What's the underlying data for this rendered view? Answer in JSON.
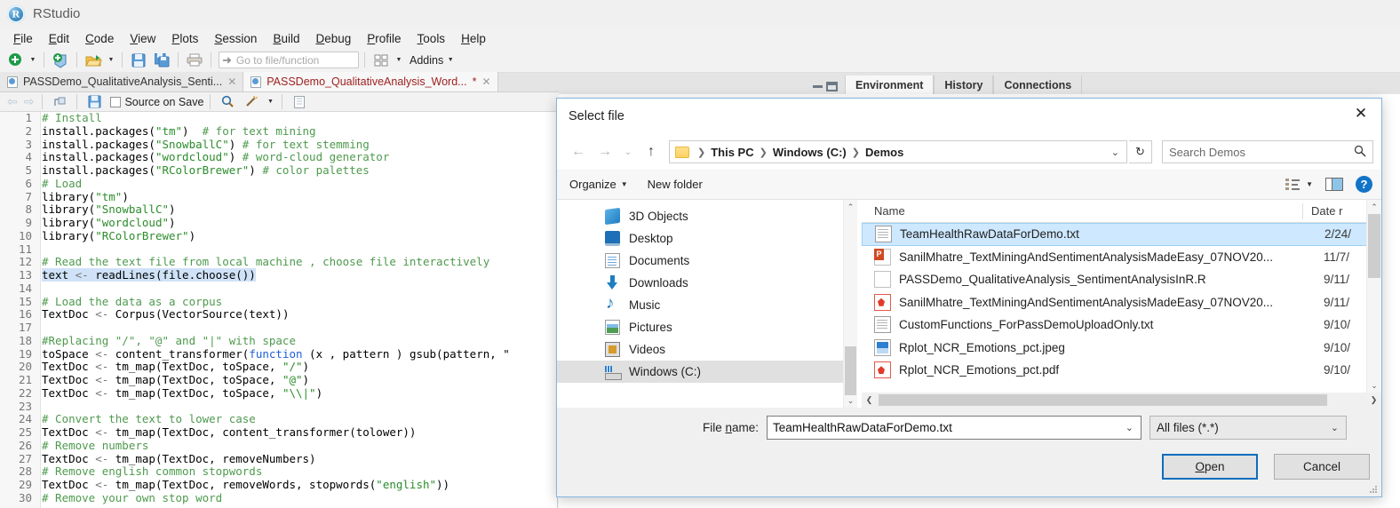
{
  "app": {
    "title": "RStudio",
    "logo_icon": "rstudio-logo"
  },
  "menubar": {
    "items": [
      {
        "label": "File",
        "mnemonic": "F"
      },
      {
        "label": "Edit",
        "mnemonic": "E"
      },
      {
        "label": "Code",
        "mnemonic": "C"
      },
      {
        "label": "View",
        "mnemonic": "V"
      },
      {
        "label": "Plots",
        "mnemonic": "P"
      },
      {
        "label": "Session",
        "mnemonic": "S"
      },
      {
        "label": "Build",
        "mnemonic": "B"
      },
      {
        "label": "Debug",
        "mnemonic": "D"
      },
      {
        "label": "Profile",
        "mnemonic": "P"
      },
      {
        "label": "Tools",
        "mnemonic": "T"
      },
      {
        "label": "Help",
        "mnemonic": "H"
      }
    ]
  },
  "toolbar": {
    "new_file_icon": "new-file-icon",
    "new_project_icon": "new-project-icon",
    "open_file_icon": "open-folder-icon",
    "save_icon": "save-icon",
    "save_all_icon": "save-all-icon",
    "print_icon": "print-icon",
    "goto_placeholder": "Go to file/function",
    "goto_icon": "goto-arrow-icon",
    "panes_icon": "workspace-panes-icon",
    "addins_label": "Addins"
  },
  "source_tabs": [
    {
      "label": "PASSDemo_QualitativeAnalysis_Senti...",
      "active": false,
      "modified": false
    },
    {
      "label": "PASSDemo_QualitativeAnalysis_Word...",
      "active": true,
      "modified": true,
      "modified_mark": "*"
    }
  ],
  "editor_toolbar": {
    "back_icon": "back-arrow-icon",
    "forward_icon": "forward-arrow-icon",
    "popout_icon": "show-in-new-window-icon",
    "save_icon": "save-icon",
    "source_on_save_label": "Source on Save",
    "find_icon": "magnifier-icon",
    "magic_icon": "code-tools-icon",
    "outline_icon": "document-outline-icon"
  },
  "code": {
    "lines": [
      {
        "n": 1,
        "segs": [
          {
            "t": "# Install",
            "c": "cm"
          }
        ]
      },
      {
        "n": 2,
        "segs": [
          {
            "t": "install.packages(",
            "c": ""
          },
          {
            "t": "\"tm\"",
            "c": "st"
          },
          {
            "t": ")  ",
            "c": ""
          },
          {
            "t": "# for text mining",
            "c": "cm"
          }
        ]
      },
      {
        "n": 3,
        "segs": [
          {
            "t": "install.packages(",
            "c": ""
          },
          {
            "t": "\"SnowballC\"",
            "c": "st"
          },
          {
            "t": ") ",
            "c": ""
          },
          {
            "t": "# for text stemming",
            "c": "cm"
          }
        ]
      },
      {
        "n": 4,
        "segs": [
          {
            "t": "install.packages(",
            "c": ""
          },
          {
            "t": "\"wordcloud\"",
            "c": "st"
          },
          {
            "t": ") ",
            "c": ""
          },
          {
            "t": "# word-cloud generator",
            "c": "cm"
          }
        ]
      },
      {
        "n": 5,
        "segs": [
          {
            "t": "install.packages(",
            "c": ""
          },
          {
            "t": "\"RColorBrewer\"",
            "c": "st"
          },
          {
            "t": ") ",
            "c": ""
          },
          {
            "t": "# color palettes",
            "c": "cm"
          }
        ]
      },
      {
        "n": 6,
        "segs": [
          {
            "t": "# Load",
            "c": "cm"
          }
        ]
      },
      {
        "n": 7,
        "segs": [
          {
            "t": "library(",
            "c": ""
          },
          {
            "t": "\"tm\"",
            "c": "st"
          },
          {
            "t": ")",
            "c": ""
          }
        ]
      },
      {
        "n": 8,
        "segs": [
          {
            "t": "library(",
            "c": ""
          },
          {
            "t": "\"SnowballC\"",
            "c": "st"
          },
          {
            "t": ")",
            "c": ""
          }
        ]
      },
      {
        "n": 9,
        "segs": [
          {
            "t": "library(",
            "c": ""
          },
          {
            "t": "\"wordcloud\"",
            "c": "st"
          },
          {
            "t": ")",
            "c": ""
          }
        ]
      },
      {
        "n": 10,
        "segs": [
          {
            "t": "library(",
            "c": ""
          },
          {
            "t": "\"RColorBrewer\"",
            "c": "st"
          },
          {
            "t": ")",
            "c": ""
          }
        ]
      },
      {
        "n": 11,
        "segs": []
      },
      {
        "n": 12,
        "segs": [
          {
            "t": "# Read the text file from local machine , choose file interactively",
            "c": "cm"
          }
        ]
      },
      {
        "n": 13,
        "segs": [
          {
            "t": "text ",
            "c": "sel"
          },
          {
            "t": "<- ",
            "c": "sel op"
          },
          {
            "t": "readLines(file.choose())",
            "c": "sel"
          }
        ]
      },
      {
        "n": 14,
        "segs": []
      },
      {
        "n": 15,
        "segs": [
          {
            "t": "# Load the data as a corpus",
            "c": "cm"
          }
        ]
      },
      {
        "n": 16,
        "segs": [
          {
            "t": "TextDoc ",
            "c": ""
          },
          {
            "t": "<- ",
            "c": "op"
          },
          {
            "t": "Corpus(VectorSource(text))",
            "c": ""
          }
        ]
      },
      {
        "n": 17,
        "segs": []
      },
      {
        "n": 18,
        "segs": [
          {
            "t": "#Replacing \"/\", \"@\" and \"|\" with space",
            "c": "cm"
          }
        ]
      },
      {
        "n": 19,
        "segs": [
          {
            "t": "toSpace ",
            "c": ""
          },
          {
            "t": "<- ",
            "c": "op"
          },
          {
            "t": "content_transformer(",
            "c": ""
          },
          {
            "t": "function",
            "c": "kw"
          },
          {
            "t": " (x , pattern ) gsub(pattern, \"",
            "c": ""
          }
        ]
      },
      {
        "n": 20,
        "segs": [
          {
            "t": "TextDoc ",
            "c": ""
          },
          {
            "t": "<- ",
            "c": "op"
          },
          {
            "t": "tm_map(TextDoc, toSpace, ",
            "c": ""
          },
          {
            "t": "\"/\"",
            "c": "st"
          },
          {
            "t": ")",
            "c": ""
          }
        ]
      },
      {
        "n": 21,
        "segs": [
          {
            "t": "TextDoc ",
            "c": ""
          },
          {
            "t": "<- ",
            "c": "op"
          },
          {
            "t": "tm_map(TextDoc, toSpace, ",
            "c": ""
          },
          {
            "t": "\"@\"",
            "c": "st"
          },
          {
            "t": ")",
            "c": ""
          }
        ]
      },
      {
        "n": 22,
        "segs": [
          {
            "t": "TextDoc ",
            "c": ""
          },
          {
            "t": "<- ",
            "c": "op"
          },
          {
            "t": "tm_map(TextDoc, toSpace, ",
            "c": ""
          },
          {
            "t": "\"\\\\|\"",
            "c": "st"
          },
          {
            "t": ")",
            "c": ""
          }
        ]
      },
      {
        "n": 23,
        "segs": []
      },
      {
        "n": 24,
        "segs": [
          {
            "t": "# Convert the text to lower case",
            "c": "cm"
          }
        ]
      },
      {
        "n": 25,
        "segs": [
          {
            "t": "TextDoc ",
            "c": ""
          },
          {
            "t": "<- ",
            "c": "op"
          },
          {
            "t": "tm_map(TextDoc, content_transformer(tolower))",
            "c": ""
          }
        ]
      },
      {
        "n": 26,
        "segs": [
          {
            "t": "# Remove numbers",
            "c": "cm"
          }
        ]
      },
      {
        "n": 27,
        "segs": [
          {
            "t": "TextDoc ",
            "c": ""
          },
          {
            "t": "<- ",
            "c": "op"
          },
          {
            "t": "tm_map(TextDoc, removeNumbers)",
            "c": ""
          }
        ]
      },
      {
        "n": 28,
        "segs": [
          {
            "t": "# Remove english common stopwords",
            "c": "cm"
          }
        ]
      },
      {
        "n": 29,
        "segs": [
          {
            "t": "TextDoc ",
            "c": ""
          },
          {
            "t": "<- ",
            "c": "op"
          },
          {
            "t": "tm_map(TextDoc, removeWords, stopwords(",
            "c": ""
          },
          {
            "t": "\"english\"",
            "c": "st"
          },
          {
            "t": "))",
            "c": ""
          }
        ]
      },
      {
        "n": 30,
        "segs": [
          {
            "t": "# Remove your own stop word",
            "c": "cm"
          }
        ]
      }
    ]
  },
  "right_pane": {
    "tabs": [
      {
        "label": "Environment",
        "active": true
      },
      {
        "label": "History",
        "active": false
      },
      {
        "label": "Connections",
        "active": false
      }
    ],
    "minimize_icon": "minimize-pane-icon",
    "maximize_icon": "maximize-pane-icon"
  },
  "dialog": {
    "title": "Select file",
    "close_icon": "close-icon",
    "nav": {
      "back_icon": "back-arrow-icon",
      "forward_icon": "forward-arrow-icon",
      "recent_icon": "chevron-down-icon",
      "up_icon": "up-arrow-icon",
      "folder_icon": "folder-icon",
      "breadcrumbs": [
        "This PC",
        "Windows (C:)",
        "Demos"
      ],
      "breadcrumb_caret_icon": "chevron-down-icon",
      "refresh_icon": "refresh-icon",
      "search_placeholder": "Search Demos",
      "search_icon": "search-icon"
    },
    "commandbar": {
      "organize_label": "Organize",
      "organize_caret_icon": "chevron-down-icon",
      "new_folder_label": "New folder",
      "view_icon": "view-list-icon",
      "view_caret_icon": "chevron-down-icon",
      "preview_pane_icon": "preview-pane-icon",
      "help_icon": "help-icon",
      "help_glyph": "?"
    },
    "sidebar": {
      "items": [
        {
          "label": "3D Objects",
          "icon": "3d-objects-icon",
          "selected": false
        },
        {
          "label": "Desktop",
          "icon": "desktop-icon",
          "selected": false
        },
        {
          "label": "Documents",
          "icon": "documents-icon",
          "selected": false
        },
        {
          "label": "Downloads",
          "icon": "downloads-icon",
          "selected": false
        },
        {
          "label": "Music",
          "icon": "music-icon",
          "selected": false
        },
        {
          "label": "Pictures",
          "icon": "pictures-icon",
          "selected": false
        },
        {
          "label": "Videos",
          "icon": "videos-icon",
          "selected": false
        },
        {
          "label": "Windows (C:)",
          "icon": "drive-icon",
          "selected": true
        }
      ],
      "scroll_up_icon": "chevron-up-icon",
      "scroll_down_icon": "chevron-down-icon"
    },
    "filelist": {
      "columns": [
        {
          "label": "Name"
        },
        {
          "label": "Date r"
        }
      ],
      "rows": [
        {
          "name": "TeamHealthRawDataForDemo.txt",
          "date": "2/24/",
          "icon": "text-file-icon",
          "selected": true
        },
        {
          "name": "SanilMhatre_TextMiningAndSentimentAnalysisMadeEasy_07NOV20...",
          "date": "11/7/",
          "icon": "powerpoint-file-icon",
          "selected": false
        },
        {
          "name": "PASSDemo_QualitativeAnalysis_SentimentAnalysisInR.R",
          "date": "9/11/",
          "icon": "blank-file-icon",
          "selected": false
        },
        {
          "name": "SanilMhatre_TextMiningAndSentimentAnalysisMadeEasy_07NOV20...",
          "date": "9/11/",
          "icon": "pdf-file-icon",
          "selected": false
        },
        {
          "name": "CustomFunctions_ForPassDemoUploadOnly.txt",
          "date": "9/10/",
          "icon": "text-file-icon",
          "selected": false
        },
        {
          "name": "Rplot_NCR_Emotions_pct.jpeg",
          "date": "9/10/",
          "icon": "image-file-icon",
          "selected": false
        },
        {
          "name": "Rplot_NCR_Emotions_pct.pdf",
          "date": "9/10/",
          "icon": "pdf-file-icon",
          "selected": false
        }
      ],
      "hscroll_left_icon": "chevron-left-icon",
      "hscroll_right_icon": "chevron-right-icon",
      "vscroll_up_icon": "chevron-up-icon",
      "vscroll_down_icon": "chevron-down-icon"
    },
    "footer": {
      "filename_label": "File name:",
      "filename_value": "TeamHealthRawDataForDemo.txt",
      "filename_caret_icon": "chevron-down-icon",
      "filter_value": "All files (*.*)",
      "filter_caret_icon": "chevron-down-icon",
      "open_label": "Open",
      "open_mnemonic": "O",
      "cancel_label": "Cancel",
      "resize_grip_icon": "resize-grip-icon"
    }
  },
  "colors": {
    "accent": "#0f6cbd",
    "selection_blue": "#cde8ff",
    "code_comment": "#4e9a4e",
    "code_string": "#2b8c2b",
    "code_keyword": "#1e5fd8",
    "tab_active_text": "#a02020"
  }
}
